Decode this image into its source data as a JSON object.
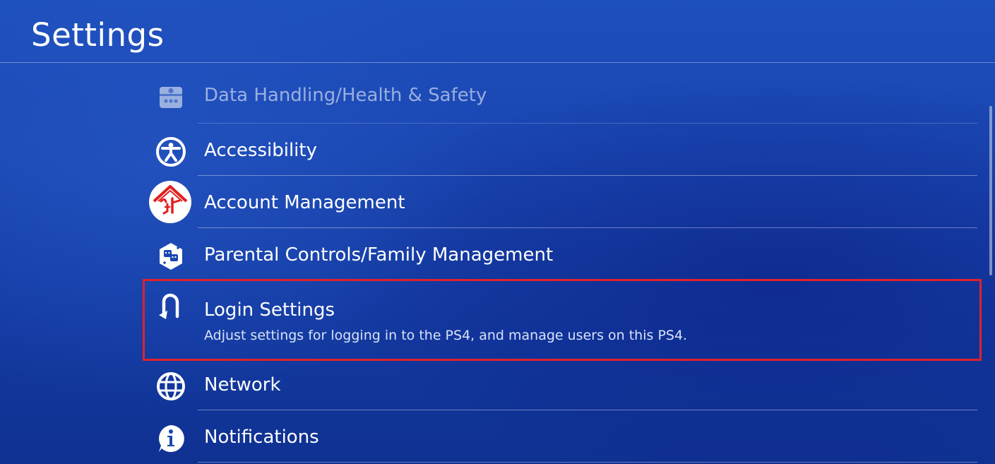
{
  "header": {
    "title": "Settings"
  },
  "menu": {
    "items": [
      {
        "label": "Data Handling/Health & Safety",
        "icon": "data-handling-icon"
      },
      {
        "label": "Accessibility",
        "icon": "accessibility-icon"
      },
      {
        "label": "Account Management",
        "icon": "watermark-logo"
      },
      {
        "label": "Parental Controls/Family Management",
        "icon": "parental-controls-icon"
      },
      {
        "label": "Login Settings",
        "description": "Adjust settings for logging in to the PS4, and manage users on this PS4.",
        "icon": "login-icon"
      },
      {
        "label": "Network",
        "icon": "globe-icon"
      },
      {
        "label": "Notifications",
        "icon": "info-icon"
      }
    ]
  },
  "colors": {
    "background": "#1a45b0",
    "highlight_border": "#e0222a",
    "text": "#ffffff"
  }
}
